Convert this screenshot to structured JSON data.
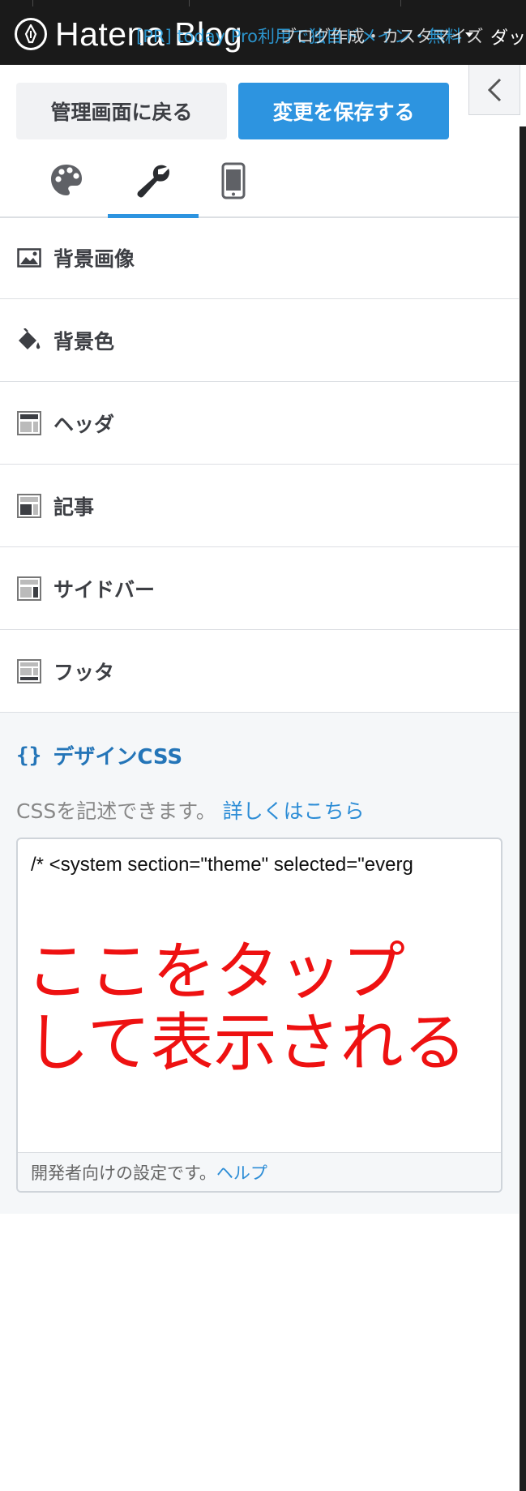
{
  "header": {
    "logo_text": "Hatena Blog",
    "pr_link": "[PR] today Pro利用で独自ドメイン・無料",
    "menu_text": "ブログ作成・カスタマイズ",
    "dash_text": "ダッ"
  },
  "toolbar": {
    "back_label": "管理画面に戻る",
    "save_label": "変更を保存する"
  },
  "tabs": [
    {
      "name": "design",
      "icon": "palette-icon",
      "active": false
    },
    {
      "name": "customize",
      "icon": "wrench-icon",
      "active": true
    },
    {
      "name": "smartphone",
      "icon": "smartphone-icon",
      "active": false
    }
  ],
  "menu": {
    "items": [
      {
        "label": "背景画像",
        "icon": "image-icon"
      },
      {
        "label": "背景色",
        "icon": "paint-bucket-icon"
      },
      {
        "label": "ヘッダ",
        "icon": "layout-header-icon"
      },
      {
        "label": "記事",
        "icon": "layout-article-icon"
      },
      {
        "label": "サイドバー",
        "icon": "layout-sidebar-icon"
      },
      {
        "label": "フッタ",
        "icon": "layout-footer-icon"
      }
    ]
  },
  "design_css": {
    "braces": "{}",
    "title": "デザインCSS",
    "description": "CSSを記述できます。",
    "details_link": "詳しくはこちら",
    "code_text": "/* <system section=\"theme\" selected=\"everg",
    "annotation_line1": "ここをタップ",
    "annotation_line2": "して表示される",
    "footer_text": "開発者向けの設定です。",
    "help_link": "ヘルプ"
  },
  "colors": {
    "accent": "#2d94e0",
    "annotation": "#ee1111",
    "link": "#2d8dd6",
    "section_title": "#2475b8"
  }
}
